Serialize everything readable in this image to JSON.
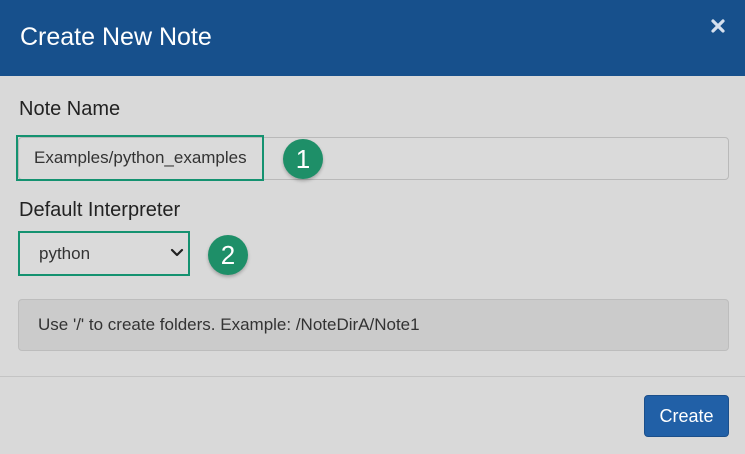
{
  "dialog": {
    "title": "Create New Note",
    "close_icon": "close-icon"
  },
  "note_name": {
    "label": "Note Name",
    "value": "Examples/python_examples",
    "callout": "1"
  },
  "interpreter": {
    "label": "Default Interpreter",
    "selected": "python",
    "callout": "2"
  },
  "info": {
    "text": "Use '/' to create folders. Example: /NoteDirA/Note1"
  },
  "footer": {
    "create_label": "Create"
  },
  "colors": {
    "header": "#17508c",
    "accent_highlight": "#149270",
    "badge": "#1e8f68",
    "primary_button": "#2160a7"
  }
}
